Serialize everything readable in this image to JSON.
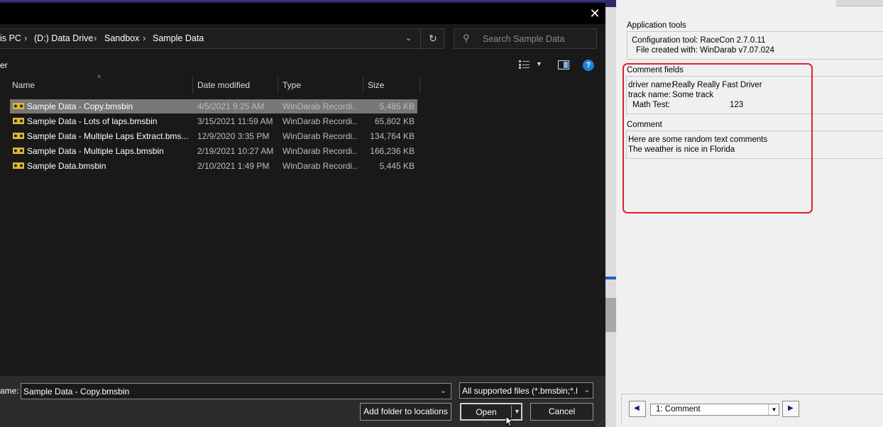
{
  "dialog": {
    "breadcrumbs": [
      "is PC",
      "(D:) Data Drive",
      "Sandbox",
      "Sample Data"
    ],
    "search_placeholder": "Search Sample Data",
    "left_toolbar_fragment": "er",
    "columns": [
      "Name",
      "Date modified",
      "Type",
      "Size"
    ],
    "files": [
      {
        "name": "Sample Data - Copy.bmsbin",
        "date": "4/5/2021 9:25 AM",
        "type": "WinDarab Recordi...",
        "size": "5,485 KB",
        "selected": true
      },
      {
        "name": "Sample Data - Lots of laps.bmsbin",
        "date": "3/15/2021 11:59 AM",
        "type": "WinDarab Recordi...",
        "size": "65,802 KB",
        "selected": false
      },
      {
        "name": "Sample Data - Multiple Laps Extract.bms...",
        "date": "12/9/2020 3:35 PM",
        "type": "WinDarab Recordi...",
        "size": "134,764 KB",
        "selected": false
      },
      {
        "name": "Sample Data - Multiple Laps.bmsbin",
        "date": "2/19/2021 10:27 AM",
        "type": "WinDarab Recordi...",
        "size": "166,236 KB",
        "selected": false
      },
      {
        "name": "Sample Data.bmsbin",
        "date": "2/10/2021 1:49 PM",
        "type": "WinDarab Recordi...",
        "size": "5,445 KB",
        "selected": false
      }
    ],
    "filename_label": "ame:",
    "filename_value": "Sample Data - Copy.bmsbin",
    "filter_value": "All supported files (*.bmsbin;*.l",
    "add_folder_label": "Add folder to locations",
    "open_label": "Open",
    "cancel_label": "Cancel"
  },
  "panel": {
    "app_tools_title": "Application tools",
    "config_tool": "Configuration tool: RaceCon 2.7.0.11",
    "file_created": "File created with: WinDarab v7.07.024",
    "comment_fields_title": "Comment fields",
    "fields": [
      {
        "label": "driver name:",
        "value": "Really Really Fast Driver"
      },
      {
        "label": "track name:",
        "value": "Some track"
      },
      {
        "label": "Math Test:",
        "value": "123"
      }
    ],
    "comment_title": "Comment",
    "comment_lines": [
      "Here are some random text comments",
      "The weather is nice in Florida"
    ],
    "selector_value": "1: Comment"
  },
  "colors": {
    "highlight": "#e0202a",
    "selected_row": "#777777",
    "help_blue": "#1e7fd6"
  }
}
